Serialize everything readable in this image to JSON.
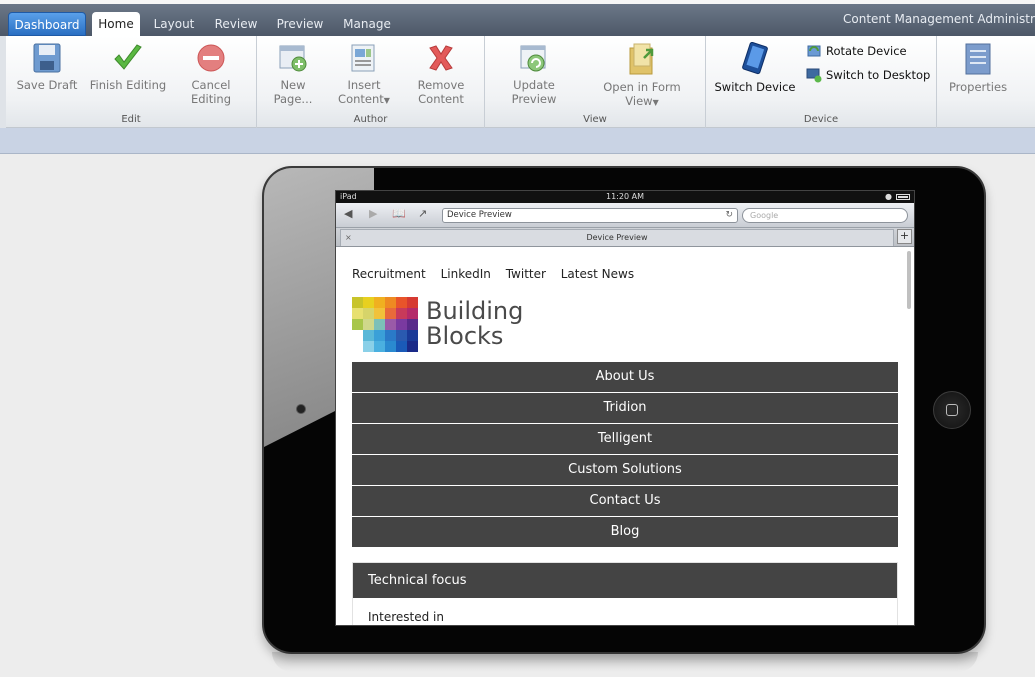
{
  "tabs": {
    "dashboard": "Dashboard",
    "home": "Home",
    "layout": "Layout",
    "review": "Review",
    "preview": "Preview",
    "manage": "Manage"
  },
  "app_title": "Content Management Administrati",
  "ribbon": {
    "edit": {
      "group_label": "Edit",
      "save_draft": "Save Draft",
      "finish_editing": "Finish Editing",
      "cancel_editing_1": "Cancel",
      "cancel_editing_2": "Editing"
    },
    "author": {
      "group_label": "Author",
      "new_page_1": "New",
      "new_page_2": "Page...",
      "insert_content_1": "Insert",
      "insert_content_2": "Content",
      "remove_content_1": "Remove",
      "remove_content_2": "Content"
    },
    "view": {
      "group_label": "View",
      "update_preview_1": "Update",
      "update_preview_2": "Preview",
      "open_form_view_1": "Open in Form",
      "open_form_view_2": "View"
    },
    "device": {
      "group_label": "Device",
      "switch_device": "Switch Device",
      "rotate_device": "Rotate Device",
      "switch_to_desktop": "Switch to Desktop"
    },
    "properties": "Properties"
  },
  "device": {
    "statusbar": {
      "carrier": "iPad",
      "time": "11:20 AM"
    },
    "browser": {
      "url": "Device Preview",
      "search_placeholder": "Google",
      "tab_title": "Device Preview"
    },
    "site": {
      "top_links": [
        "Recruitment",
        "LinkedIn",
        "Twitter",
        "Latest News"
      ],
      "logo_line1": "Building",
      "logo_line2": "Blocks",
      "nav": [
        "About Us",
        "Tridion",
        "Telligent",
        "Custom Solutions",
        "Contact Us",
        "Blog"
      ],
      "panel_title": "Technical focus",
      "panel_text": "Interested in"
    }
  },
  "colors": {
    "nav_bg": "#444444",
    "dashboard_tab": "#2a6fc2",
    "subbar": "#c9d3e4"
  }
}
